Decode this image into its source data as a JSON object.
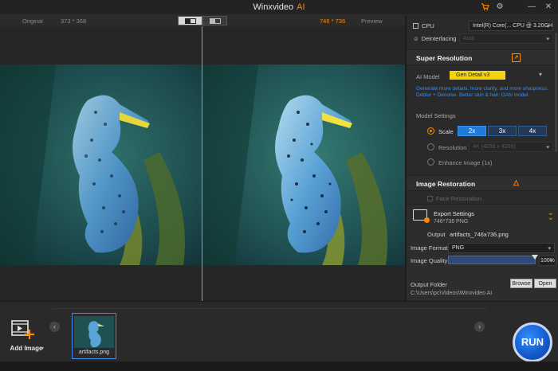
{
  "app": {
    "title": "Winxvideo",
    "title_ai": "AI",
    "accent_color": "#ff8a00"
  },
  "titlebar_icons": [
    "cart-icon",
    "gear-icon",
    "minimize-icon",
    "close-icon"
  ],
  "compare": {
    "original_label": "Original",
    "original_size": "373 * 368",
    "output_size": "746 * 736",
    "preview_label": "Preview"
  },
  "panel": {
    "device_label": "CPU",
    "device_value": "Intel(R) Core(... CPU @ 3.20GH",
    "deinterlacing_label": "Deinterlacing",
    "deinterlacing_value": "Auto",
    "super_resolution": {
      "title": "Super Resolution",
      "ai_model_label": "AI Model",
      "ai_model_value": "Gen Detail v3",
      "description": "Generate more details, more clarity, and more sharpness. Deblur + Denoise. Better skin & hair. GAN model.",
      "model_settings_label": "Model Settings",
      "scale_label": "Scale",
      "scale_options": [
        "2x",
        "3x",
        "4x"
      ],
      "scale_selected": "2x",
      "resolution_label": "Resolution",
      "resolution_value": "4K (4096 x 4096)",
      "enhance_label": "Enhance Image (1x)"
    },
    "image_restoration": {
      "title": "Image Restoration",
      "face_restoration_label": "Face Restoration"
    },
    "export": {
      "title": "Export Settings",
      "summary": "746*736  PNG",
      "output_label": "Output",
      "output_value": "artifacts_746x736.png",
      "format_label": "Image Format",
      "format_value": "PNG",
      "quality_label": "Image Quality",
      "quality_value": "100%",
      "quality_fraction": 1.0,
      "folder_label": "Output Folder",
      "folder_path": "C:\\Users\\pc\\Videos\\Winxvideo AI",
      "browse_label": "Browse",
      "open_label": "Open"
    }
  },
  "bottom": {
    "add_image_label": "Add Image",
    "thumbnail_label": "artifacts.png",
    "run_label": "RUN"
  }
}
